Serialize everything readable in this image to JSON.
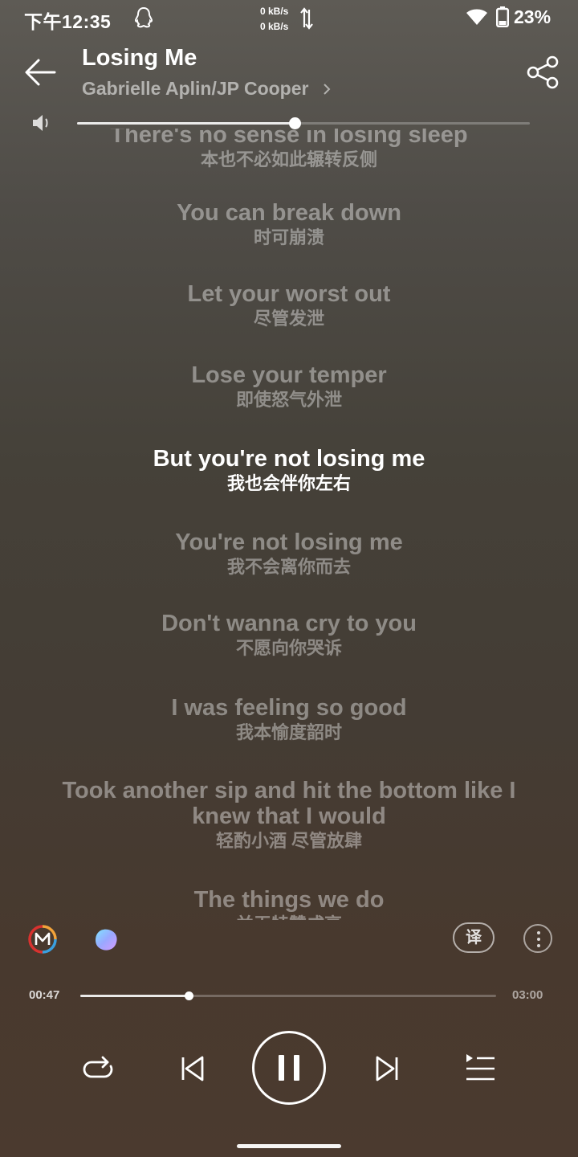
{
  "status_bar": {
    "time": "下午12:35",
    "net_up": "0 kB/s",
    "net_down": "0 kB/s",
    "battery": "23%"
  },
  "header": {
    "title": "Losing Me",
    "artist": "Gabrielle Aplin/JP Cooper"
  },
  "volume": {
    "level": 0.48
  },
  "lyrics": [
    {
      "en": "There's no sense in losing sleep",
      "zh": "本也不必如此辗转反侧"
    },
    {
      "en": "You can break down",
      "zh": "时可崩溃"
    },
    {
      "en": "Let your worst out",
      "zh": "尽管发泄"
    },
    {
      "en": "Lose your temper",
      "zh": "即使怒气外泄"
    },
    {
      "en": "But you're not losing me",
      "zh": "我也会伴你左右",
      "current": true
    },
    {
      "en": "You're not losing me",
      "zh": "我不会离你而去"
    },
    {
      "en": "Don't wanna cry to you",
      "zh": "不愿向你哭诉"
    },
    {
      "en": "I was feeling so good",
      "zh": "我本愉度韶时"
    },
    {
      "en": "Took another sip and hit the bottom like I knew that I would",
      "zh": "轻酌小酒 尽管放肆"
    },
    {
      "en": "The things we do",
      "zh": "并无特赞成享"
    }
  ],
  "actions": {
    "translate_label": "译"
  },
  "playback": {
    "current_time": "00:47",
    "duration": "03:00",
    "progress": 0.261,
    "state": "playing"
  },
  "icons": {
    "back": "back-arrow-icon",
    "share": "share-icon",
    "volume": "volume-icon",
    "repeat": "repeat-icon",
    "prev": "previous-icon",
    "pause": "pause-icon",
    "next": "next-icon",
    "playlist": "playlist-icon"
  }
}
